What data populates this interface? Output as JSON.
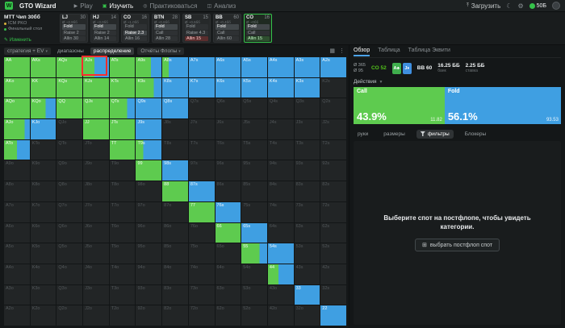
{
  "topbar": {
    "logo_letter": "W",
    "app_title": "GTO Wizard",
    "nav": [
      {
        "label": "Play",
        "icon": "play-icon",
        "active": false
      },
      {
        "label": "Изучить",
        "icon": "study-icon",
        "active": true
      },
      {
        "label": "Практиковаться",
        "icon": "practice-icon",
        "active": false
      },
      {
        "label": "Анализ",
        "icon": "analyze-icon",
        "active": false
      }
    ],
    "upload_label": "Загрузить",
    "balance": "50Б"
  },
  "toolbar": {
    "spot": {
      "title": "MTT Чип 30бб",
      "line2": "ICM PKO",
      "line3": "Финальный стол",
      "edit_label": "Изменить"
    },
    "panels": [
      {
        "pos": "LJ",
        "stack": "30",
        "sub": "Ø ~2.9бб",
        "highlight": false,
        "actions": [
          {
            "label": "Fold",
            "kind": "fold",
            "selected": true
          },
          {
            "label": "Raise 2",
            "kind": "raise",
            "selected": false
          },
          {
            "label": "Allin 30",
            "kind": "allin",
            "selected": false
          }
        ]
      },
      {
        "pos": "HJ",
        "stack": "14",
        "sub": "Ø ~3.0бб",
        "highlight": false,
        "actions": [
          {
            "label": "Fold",
            "kind": "fold",
            "selected": true
          },
          {
            "label": "Raise 2",
            "kind": "raise",
            "selected": false
          },
          {
            "label": "Allin 14",
            "kind": "allin",
            "selected": false
          }
        ]
      },
      {
        "pos": "CO",
        "stack": "16",
        "sub": "Ø ~1.0бб",
        "highlight": false,
        "actions": [
          {
            "label": "Fold",
            "kind": "fold",
            "selected": false
          },
          {
            "label": "Raise 2.3",
            "kind": "raise",
            "selected": true
          },
          {
            "label": "Allin 16",
            "kind": "allin",
            "selected": false
          }
        ]
      },
      {
        "pos": "BTN",
        "stack": "28",
        "sub": "Ø ~0.6бб",
        "highlight": false,
        "actions": [
          {
            "label": "Fold",
            "kind": "fold",
            "selected": true
          },
          {
            "label": "Call",
            "kind": "call",
            "selected": false
          },
          {
            "label": "Allin 28",
            "kind": "allin",
            "selected": false
          }
        ]
      },
      {
        "pos": "SB",
        "stack": "15",
        "sub": "Ø ~0.6бб",
        "highlight": false,
        "actions": [
          {
            "label": "Fold",
            "kind": "fold",
            "selected": false
          },
          {
            "label": "Raise 4.3",
            "kind": "raise",
            "selected": false
          },
          {
            "label": "Allin 15",
            "kind": "allin",
            "selected": true
          }
        ]
      },
      {
        "pos": "BB",
        "stack": "60",
        "sub": "Ø ~0.4бб",
        "highlight": false,
        "actions": [
          {
            "label": "Fold",
            "kind": "fold",
            "selected": true
          },
          {
            "label": "Call",
            "kind": "call",
            "selected": false
          },
          {
            "label": "Allin 60",
            "kind": "allin",
            "selected": false
          }
        ]
      },
      {
        "pos": "CO",
        "stack": "16",
        "sub": "Ø ~0бб",
        "highlight": true,
        "actions": [
          {
            "label": "Fold",
            "kind": "fold",
            "selected": true
          },
          {
            "label": "Call",
            "kind": "call",
            "selected": false
          },
          {
            "label": "Allin 15",
            "kind": "allin",
            "selected": false
          }
        ]
      }
    ]
  },
  "gridbar": {
    "tabs": [
      {
        "label": "стратегия + EV",
        "dropdown": true,
        "active": false
      },
      {
        "label": "диапазоны",
        "dropdown": false,
        "active": false
      },
      {
        "label": "распределение",
        "dropdown": false,
        "active": true
      },
      {
        "label": "Отчёты Флопы",
        "dropdown": true,
        "active": false
      }
    ]
  },
  "matrix": {
    "selected": {
      "row": 0,
      "col": 3
    },
    "colors": {
      "call": "#5ecb4f",
      "fold": "#3f9fe2",
      "out": "#222526"
    },
    "rows": [
      [
        [
          "AA",
          100
        ],
        [
          "AKs",
          100
        ],
        [
          "AQs",
          100
        ],
        [
          "AJs",
          44
        ],
        [
          "ATs",
          100
        ],
        [
          "A9s",
          60
        ],
        [
          "A8s",
          25
        ],
        [
          "A7s",
          0
        ],
        [
          "A6s",
          0
        ],
        [
          "A5s",
          0
        ],
        [
          "A4s",
          0
        ],
        [
          "A3s",
          0
        ],
        [
          "A2s",
          0
        ]
      ],
      [
        [
          "AKo",
          100
        ],
        [
          "KK",
          100
        ],
        [
          "KQs",
          100
        ],
        [
          "KJs",
          100
        ],
        [
          "KTs",
          100
        ],
        [
          "K9s",
          70
        ],
        [
          "K8s",
          0
        ],
        [
          "K7s",
          0
        ],
        [
          "K6s",
          0
        ],
        [
          "K5s",
          0
        ],
        [
          "K4s",
          0
        ],
        [
          "K3s",
          0
        ],
        [
          "K2s",
          -1
        ]
      ],
      [
        [
          "AQo",
          100
        ],
        [
          "KQo",
          60
        ],
        [
          "QQ",
          100
        ],
        [
          "QJs",
          100
        ],
        [
          "QTs",
          70
        ],
        [
          "Q9s",
          0
        ],
        [
          "Q8s",
          0
        ],
        [
          "Q7s",
          -1
        ],
        [
          "Q6s",
          -1
        ],
        [
          "Q5s",
          -1
        ],
        [
          "Q4s",
          -1
        ],
        [
          "Q3s",
          -1
        ],
        [
          "Q2s",
          -1
        ]
      ],
      [
        [
          "AJo",
          80
        ],
        [
          "KJo",
          0
        ],
        [
          "QJo",
          -1
        ],
        [
          "JJ",
          100
        ],
        [
          "JTs",
          100
        ],
        [
          "J9s",
          0
        ],
        [
          "J8s",
          -1
        ],
        [
          "J7s",
          -1
        ],
        [
          "J6s",
          -1
        ],
        [
          "J5s",
          -1
        ],
        [
          "J4s",
          -1
        ],
        [
          "J3s",
          -1
        ],
        [
          "J2s",
          -1
        ]
      ],
      [
        [
          "ATo",
          50
        ],
        [
          "KTo",
          -1
        ],
        [
          "QTo",
          -1
        ],
        [
          "JTo",
          -1
        ],
        [
          "TT",
          100
        ],
        [
          "T9s",
          30
        ],
        [
          "T8s",
          -1
        ],
        [
          "T7s",
          -1
        ],
        [
          "T6s",
          -1
        ],
        [
          "T5s",
          -1
        ],
        [
          "T4s",
          -1
        ],
        [
          "T3s",
          -1
        ],
        [
          "T2s",
          -1
        ]
      ],
      [
        [
          "A9o",
          -1
        ],
        [
          "K9o",
          -1
        ],
        [
          "Q9o",
          -1
        ],
        [
          "J9o",
          -1
        ],
        [
          "T9o",
          -1
        ],
        [
          "99",
          100
        ],
        [
          "98s",
          0
        ],
        [
          "97s",
          -1
        ],
        [
          "96s",
          -1
        ],
        [
          "95s",
          -1
        ],
        [
          "94s",
          -1
        ],
        [
          "93s",
          -1
        ],
        [
          "92s",
          -1
        ]
      ],
      [
        [
          "A8o",
          -1
        ],
        [
          "K8o",
          -1
        ],
        [
          "Q8o",
          -1
        ],
        [
          "J8o",
          -1
        ],
        [
          "T8o",
          -1
        ],
        [
          "98o",
          -1
        ],
        [
          "88",
          100
        ],
        [
          "87s",
          0
        ],
        [
          "86s",
          -1
        ],
        [
          "85s",
          -1
        ],
        [
          "84s",
          -1
        ],
        [
          "83s",
          -1
        ],
        [
          "82s",
          -1
        ]
      ],
      [
        [
          "A7o",
          -1
        ],
        [
          "K7o",
          -1
        ],
        [
          "Q7o",
          -1
        ],
        [
          "J7o",
          -1
        ],
        [
          "T7o",
          -1
        ],
        [
          "97o",
          -1
        ],
        [
          "87o",
          -1
        ],
        [
          "77",
          100
        ],
        [
          "76s",
          0
        ],
        [
          "75s",
          -1
        ],
        [
          "74s",
          -1
        ],
        [
          "73s",
          -1
        ],
        [
          "72s",
          -1
        ]
      ],
      [
        [
          "A6o",
          -1
        ],
        [
          "K6o",
          -1
        ],
        [
          "Q6o",
          -1
        ],
        [
          "J6o",
          -1
        ],
        [
          "T6o",
          -1
        ],
        [
          "96o",
          -1
        ],
        [
          "86o",
          -1
        ],
        [
          "76o",
          -1
        ],
        [
          "66",
          100
        ],
        [
          "65s",
          0
        ],
        [
          "64s",
          -1
        ],
        [
          "63s",
          -1
        ],
        [
          "62s",
          -1
        ]
      ],
      [
        [
          "A5o",
          -1
        ],
        [
          "K5o",
          -1
        ],
        [
          "Q5o",
          -1
        ],
        [
          "J5o",
          -1
        ],
        [
          "T5o",
          -1
        ],
        [
          "95o",
          -1
        ],
        [
          "85o",
          -1
        ],
        [
          "75o",
          -1
        ],
        [
          "65o",
          -1
        ],
        [
          "55",
          70
        ],
        [
          "54s",
          0
        ],
        [
          "53s",
          -1
        ],
        [
          "52s",
          -1
        ]
      ],
      [
        [
          "A4o",
          -1
        ],
        [
          "K4o",
          -1
        ],
        [
          "Q4o",
          -1
        ],
        [
          "J4o",
          -1
        ],
        [
          "T4o",
          -1
        ],
        [
          "94o",
          -1
        ],
        [
          "84o",
          -1
        ],
        [
          "74o",
          -1
        ],
        [
          "64o",
          -1
        ],
        [
          "54o",
          -1
        ],
        [
          "44",
          40
        ],
        [
          "43s",
          -1
        ],
        [
          "42s",
          -1
        ]
      ],
      [
        [
          "A3o",
          -1
        ],
        [
          "K3o",
          -1
        ],
        [
          "Q3o",
          -1
        ],
        [
          "J3o",
          -1
        ],
        [
          "T3o",
          -1
        ],
        [
          "93o",
          -1
        ],
        [
          "83o",
          -1
        ],
        [
          "73o",
          -1
        ],
        [
          "63o",
          -1
        ],
        [
          "53o",
          -1
        ],
        [
          "43o",
          -1
        ],
        [
          "33",
          0
        ],
        [
          "32s",
          -1
        ]
      ],
      [
        [
          "A2o",
          -1
        ],
        [
          "K2o",
          -1
        ],
        [
          "Q2o",
          -1
        ],
        [
          "J2o",
          -1
        ],
        [
          "T2o",
          -1
        ],
        [
          "92o",
          -1
        ],
        [
          "82o",
          -1
        ],
        [
          "72o",
          -1
        ],
        [
          "62o",
          -1
        ],
        [
          "52o",
          -1
        ],
        [
          "42o",
          -1
        ],
        [
          "32o",
          -1
        ],
        [
          "22",
          0
        ]
      ]
    ]
  },
  "right": {
    "tabs": [
      {
        "label": "Обзор",
        "active": true
      },
      {
        "label": "Таблица",
        "active": false
      },
      {
        "label": "Таблица Эквити",
        "active": false
      }
    ],
    "stats": {
      "mini": [
        {
          "value": "Ø 365"
        },
        {
          "value": "Ø 95"
        }
      ],
      "position": "CO 52",
      "cards": [
        {
          "text": "A♣",
          "color": "#3fae4d"
        },
        {
          "text": "J♦",
          "color": "#3f8fe0"
        }
      ],
      "bb": "BB 60",
      "pot": {
        "value": "16.25 ББ",
        "label": "банк"
      },
      "bet": {
        "value": "2.25 ББ",
        "label": "ставка"
      }
    },
    "actions_label": "Действия",
    "bars": [
      {
        "label": "Call",
        "pct": "43.9%",
        "width": 43.9,
        "ev": "11.82",
        "color": "#5ecb4f"
      },
      {
        "label": "Fold",
        "pct": "56.1%",
        "width": 56.1,
        "ev": "93.53",
        "color": "#3f9fe2"
      }
    ],
    "subtabs": [
      {
        "label": "руки",
        "active": false
      },
      {
        "label": "размеры",
        "active": false
      },
      {
        "label": "фильтры",
        "active": true
      },
      {
        "label": "Блокеры",
        "active": false
      }
    ],
    "empty": {
      "message": "Выберите спот на постфлопе, чтобы увидеть категории.",
      "button_label": "выбрать постфлоп спот"
    }
  }
}
